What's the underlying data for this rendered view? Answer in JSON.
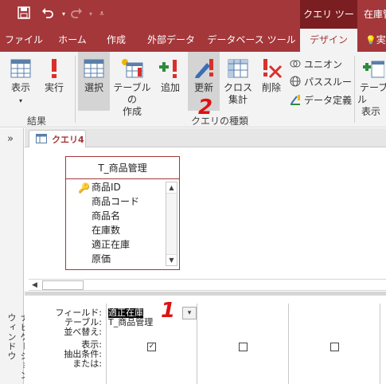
{
  "titlebar": {
    "context_tab": "クエリ ツール",
    "title_partial": "在庫管"
  },
  "tabs": [
    "ファイル",
    "ホーム",
    "作成",
    "外部データ",
    "データベース ツール",
    "デザイン",
    "実"
  ],
  "ribbon": {
    "view_label": "表示",
    "run_label": "実行",
    "results_group": "結果",
    "select_label": "選択",
    "make_table_label_1": "テーブルの",
    "make_table_label_2": "作成",
    "append_label": "追加",
    "update_label": "更新",
    "crosstab_label_1": "クロス",
    "crosstab_label_2": "集計",
    "delete_label": "削除",
    "union_label": "ユニオン",
    "passthrough_label": "パススルー",
    "data_definition_label": "データ定義",
    "query_type_group": "クエリの種類",
    "show_table_label_1": "テーブル",
    "show_table_label_2": "表示"
  },
  "nav": {
    "chevron": "»",
    "label": "ナビゲーション ウィンドウ"
  },
  "document": {
    "tab_label": "クエリ4"
  },
  "table_box": {
    "title": "T_商品管理",
    "fields": [
      "商品ID",
      "商品コード",
      "商品名",
      "在庫数",
      "適正在庫",
      "原価"
    ]
  },
  "design_grid": {
    "row_labels": [
      "フィールド:",
      "テーブル:",
      "並べ替え:",
      "表示:",
      "抽出条件:",
      "または:"
    ],
    "column1": {
      "field": "適正在庫",
      "table": "T_商品管理",
      "show": "✓"
    }
  },
  "annotations": [
    "1",
    "2"
  ],
  "colors": {
    "accent": "#a4373a",
    "annotation": "#e01010"
  }
}
